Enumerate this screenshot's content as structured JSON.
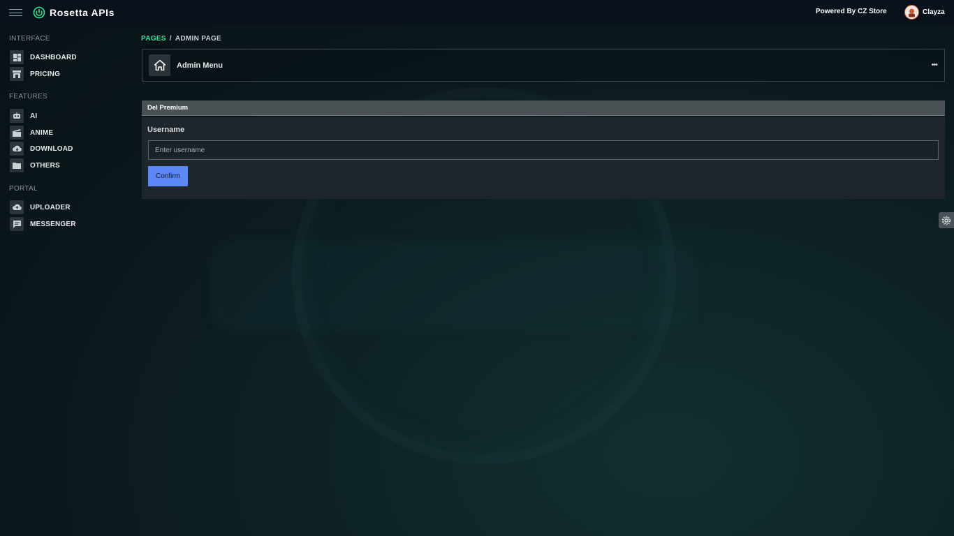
{
  "header": {
    "brand": "Rosetta APIs",
    "powered_by": "Powered By CZ Store",
    "user_name": "Clayza"
  },
  "sidebar": {
    "sections": [
      {
        "title": "INTERFACE",
        "items": [
          {
            "label": "DASHBOARD",
            "icon": "dashboard-icon"
          },
          {
            "label": "PRICING",
            "icon": "store-icon"
          }
        ]
      },
      {
        "title": "FEATURES",
        "items": [
          {
            "label": "AI",
            "icon": "robot-icon"
          },
          {
            "label": "ANIME",
            "icon": "clapperboard-icon"
          },
          {
            "label": "DOWNLOAD",
            "icon": "cloud-download-icon"
          },
          {
            "label": "OTHERS",
            "icon": "folder-icon"
          }
        ]
      },
      {
        "title": "PORTAL",
        "items": [
          {
            "label": "UPLOADER",
            "icon": "cloud-upload-icon"
          },
          {
            "label": "MESSENGER",
            "icon": "chat-icon"
          }
        ]
      }
    ]
  },
  "breadcrumb": {
    "link": "PAGES",
    "separator": "/",
    "current": "ADMIN PAGE"
  },
  "admin_card": {
    "title": "Admin Menu",
    "menu": "•••"
  },
  "form": {
    "header": "Del Premium",
    "username_label": "Username",
    "username_placeholder": "Enter username",
    "username_value": "",
    "confirm_label": "Confirm"
  },
  "colors": {
    "accent": "#2ee59d",
    "button": "#5b88f6",
    "background": "#0d1f23"
  }
}
